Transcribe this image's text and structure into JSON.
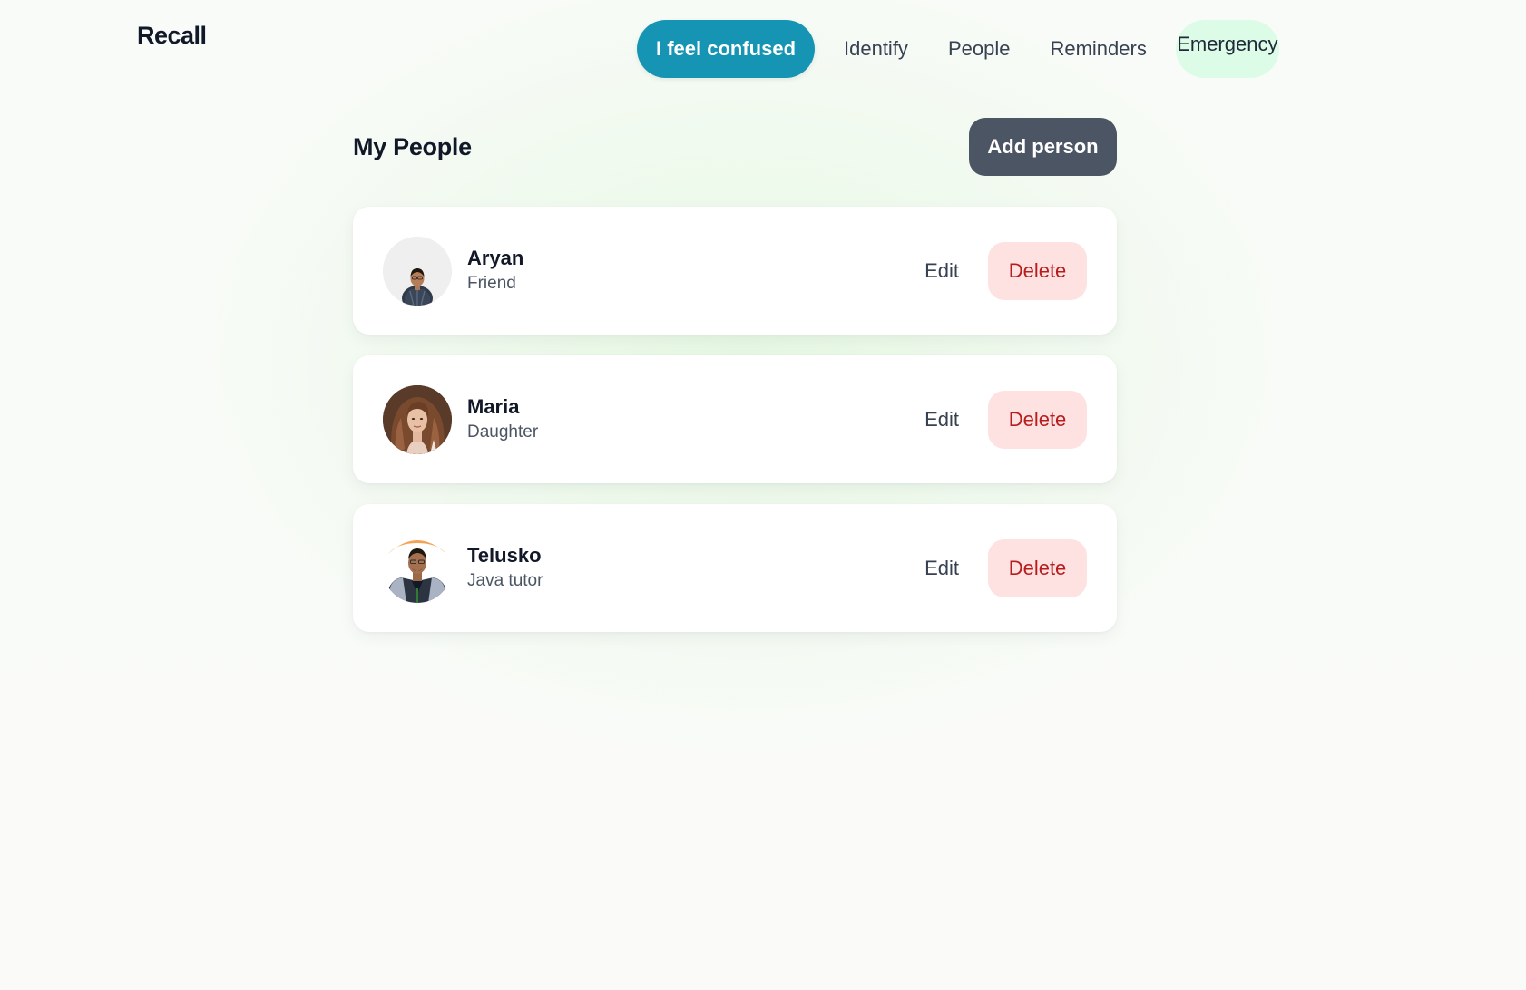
{
  "header": {
    "logo": "Recall",
    "nav": {
      "confused": "I feel confused",
      "identify": "Identify",
      "people": "People",
      "reminders": "Reminders",
      "emergency": "Emergency"
    }
  },
  "page": {
    "title": "My People",
    "add_button": "Add person"
  },
  "people": [
    {
      "name": "Aryan",
      "relation": "Friend",
      "edit": "Edit",
      "delete": "Delete"
    },
    {
      "name": "Maria",
      "relation": "Daughter",
      "edit": "Edit",
      "delete": "Delete"
    },
    {
      "name": "Telusko",
      "relation": "Java tutor",
      "edit": "Edit",
      "delete": "Delete"
    }
  ],
  "colors": {
    "accent": "#1594b4",
    "emergency_bg": "#dcfce7",
    "add_button_bg": "#4b5563",
    "delete_bg": "#fee2e2",
    "delete_text": "#b91c1c"
  }
}
